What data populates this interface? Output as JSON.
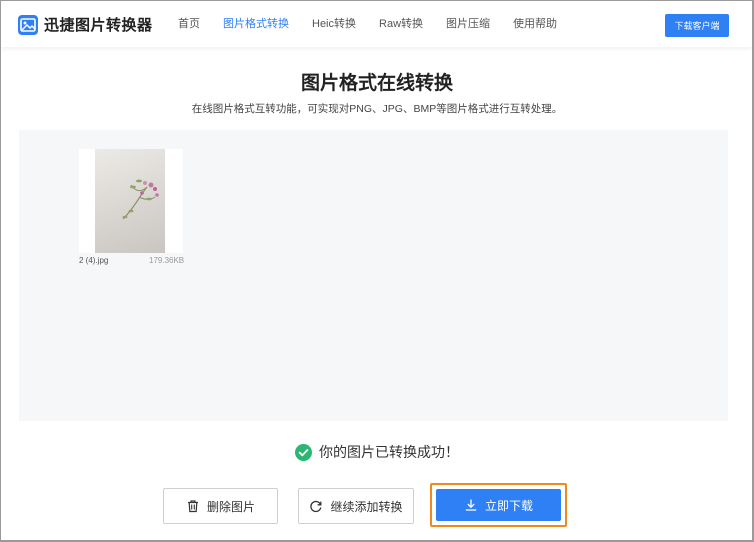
{
  "header": {
    "logo_text": "迅捷图片转换器",
    "nav": [
      {
        "label": "首页",
        "active": false
      },
      {
        "label": "图片格式转换",
        "active": true
      },
      {
        "label": "Heic转换",
        "active": false
      },
      {
        "label": "Raw转换",
        "active": false
      },
      {
        "label": "图片压缩",
        "active": false
      },
      {
        "label": "使用帮助",
        "active": false
      }
    ],
    "download_client_label": "下载客户端"
  },
  "main": {
    "title": "图片格式在线转换",
    "subtitle": "在线图片格式互转功能，可实现对PNG、JPG、BMP等图片格式进行互转处理。"
  },
  "files": [
    {
      "name": "2 (4).jpg",
      "size": "179.36KB"
    }
  ],
  "status": {
    "success_text": "你的图片已转换成功！"
  },
  "actions": {
    "delete_label": "删除图片",
    "add_label": "继续添加转换",
    "download_label": "立即下载"
  },
  "colors": {
    "accent": "#2f7ff5",
    "success": "#2bb673",
    "highlight": "#f08a1c"
  }
}
